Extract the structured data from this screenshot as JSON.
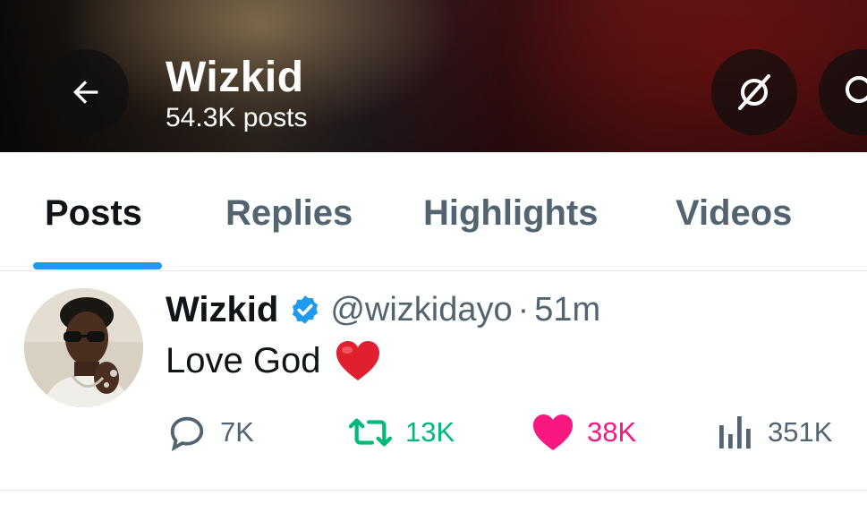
{
  "header": {
    "name": "Wizkid",
    "post_count": "54.3K posts",
    "icons": {
      "back": "arrow-left-icon",
      "grok": "grok-icon",
      "search": "search-icon"
    }
  },
  "tabs": [
    {
      "label": "Posts",
      "active": true
    },
    {
      "label": "Replies",
      "active": false
    },
    {
      "label": "Highlights",
      "active": false
    },
    {
      "label": "Videos",
      "active": false
    }
  ],
  "post": {
    "author_name": "Wizkid",
    "handle": "@wizkidayo",
    "separator": "·",
    "time": "51m",
    "text": "Love God",
    "emoji": "heart-emoji",
    "stats": {
      "replies": "7K",
      "reposts": "13K",
      "likes": "38K",
      "views": "351K"
    }
  },
  "colors": {
    "accent": "#1d9bf0",
    "secondary_text": "#536471",
    "repost_green": "#00ba7c",
    "like_pink": "#f91880",
    "verified_blue": "#1d9bf0"
  }
}
